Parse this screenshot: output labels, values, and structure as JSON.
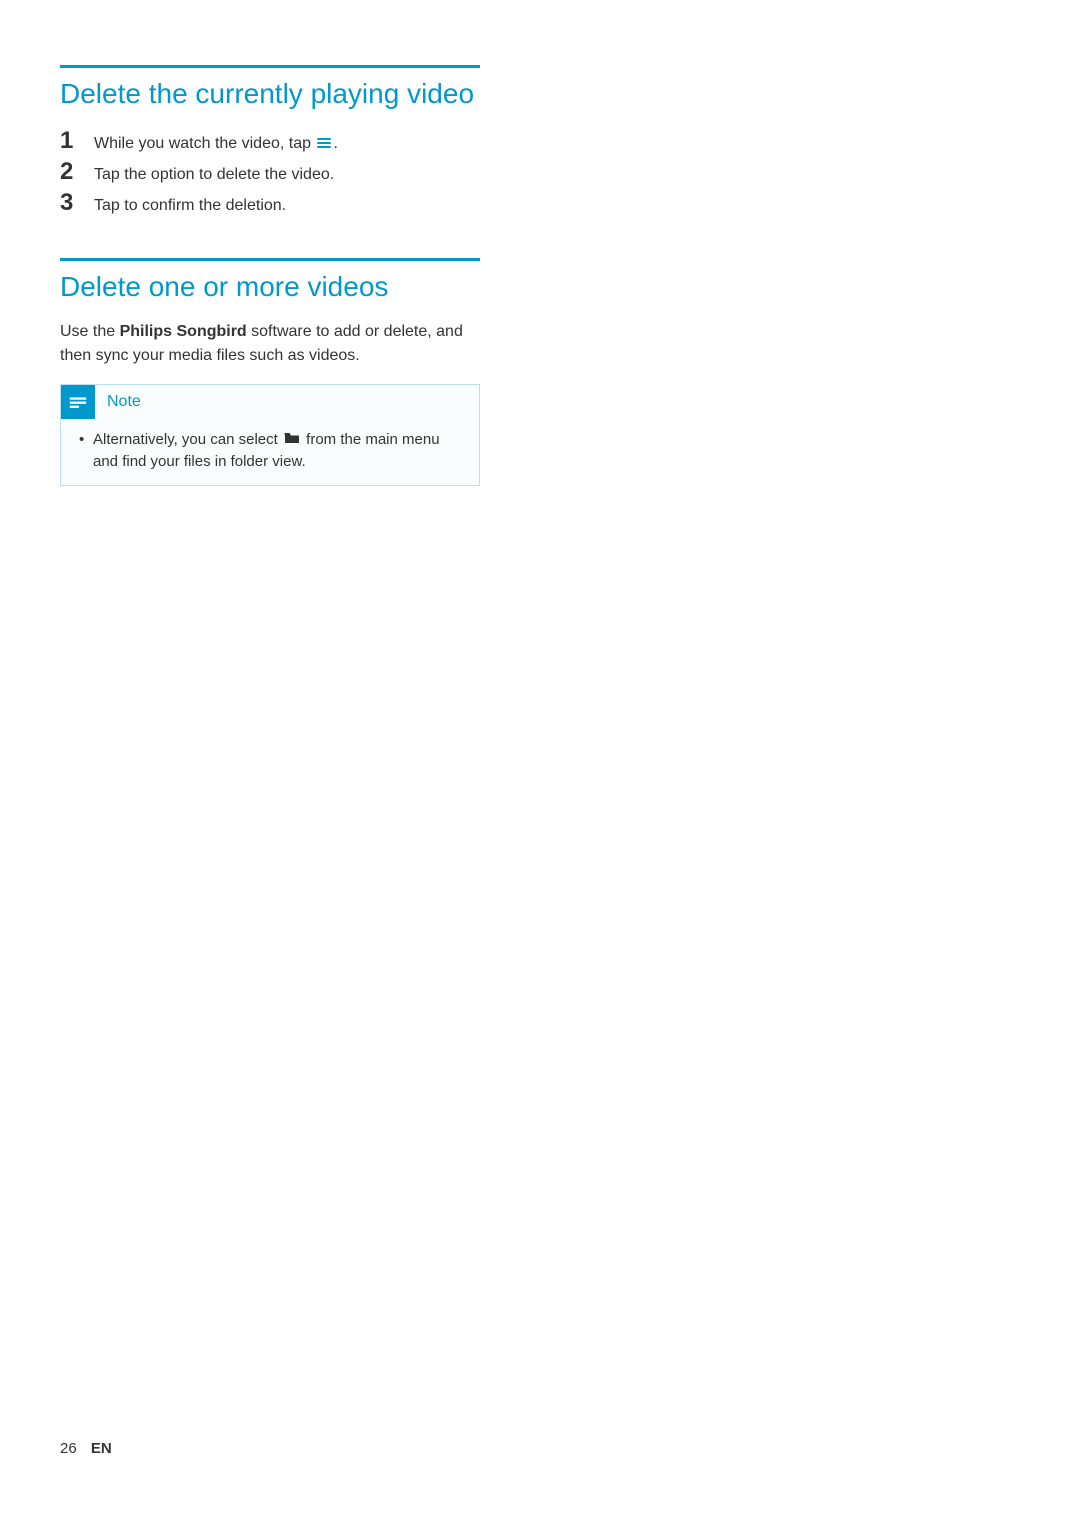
{
  "section1": {
    "heading": "Delete the currently playing video",
    "steps": [
      {
        "num": "1",
        "text_before": "While you watch the video, tap ",
        "has_menu_icon": true,
        "text_after": "."
      },
      {
        "num": "2",
        "text_before": "Tap the option to delete the video.",
        "has_menu_icon": false,
        "text_after": ""
      },
      {
        "num": "3",
        "text_before": "Tap to confirm the deletion.",
        "has_menu_icon": false,
        "text_after": ""
      }
    ]
  },
  "section2": {
    "heading": "Delete one or more videos",
    "paragraph_pre": "Use the ",
    "paragraph_bold": "Philips Songbird",
    "paragraph_post": " software to add or delete, and then sync your media files such as videos."
  },
  "note": {
    "title": "Note",
    "bullet_pre": "Alternatively, you can select ",
    "bullet_post": " from the main menu and find your files in folder view."
  },
  "footer": {
    "page_num": "26",
    "lang": "EN"
  }
}
